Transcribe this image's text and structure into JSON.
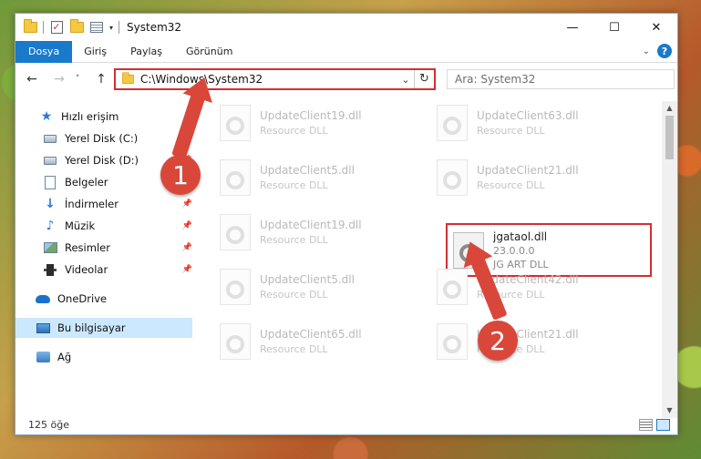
{
  "window": {
    "title": "System32",
    "minimize": "—",
    "maximize": "☐",
    "close": "✕"
  },
  "ribbon": {
    "tabs": [
      "Dosya",
      "Giriş",
      "Paylaş",
      "Görünüm"
    ],
    "help": "?"
  },
  "nav": {
    "back": "←",
    "forward": "→",
    "recent": "˅",
    "up": "↑"
  },
  "address": {
    "path": "C:\\Windows\\System32",
    "refresh": "↻"
  },
  "search": {
    "placeholder": "Ara: System32"
  },
  "sidebar": {
    "items": [
      {
        "label": "Hızlı erişim",
        "icon": "star-icon",
        "pinned": false
      },
      {
        "label": "Yerel Disk (C:)",
        "icon": "drive-icon",
        "pinned": true
      },
      {
        "label": "Yerel Disk (D:)",
        "icon": "drive-icon",
        "pinned": true
      },
      {
        "label": "Belgeler",
        "icon": "document-icon",
        "pinned": true
      },
      {
        "label": "İndirmeler",
        "icon": "download-icon",
        "pinned": true
      },
      {
        "label": "Müzik",
        "icon": "music-icon",
        "pinned": true
      },
      {
        "label": "Resimler",
        "icon": "pictures-icon",
        "pinned": true
      },
      {
        "label": "Videolar",
        "icon": "video-icon",
        "pinned": true
      },
      {
        "label": "OneDrive",
        "icon": "cloud-icon",
        "pinned": false
      },
      {
        "label": "Bu bilgisayar",
        "icon": "computer-icon",
        "pinned": false,
        "selected": true
      },
      {
        "label": "Ağ",
        "icon": "network-icon",
        "pinned": false
      }
    ]
  },
  "files": [
    {
      "name": "UpdateClient19.dll",
      "desc": "Resource DLL"
    },
    {
      "name": "UpdateClient63.dll",
      "desc": "Resource DLL"
    },
    {
      "name": "UpdateClient5.dll",
      "desc": "Resource DLL"
    },
    {
      "name": "UpdateClient21.dll",
      "desc": "Resource DLL"
    },
    {
      "name": "UpdateClient19.dll",
      "desc": "Resource DLL"
    },
    {
      "name": "UpdateClient5.dll",
      "desc": "Resource DLL"
    },
    {
      "name": "UpdateClient42.dll",
      "desc": "Resource DLL"
    },
    {
      "name": "UpdateClient65.dll",
      "desc": "Resource DLL"
    },
    {
      "name": "UpdateClient21.dll",
      "desc": "Resource DLL"
    }
  ],
  "highlighted_file": {
    "name": "jgataol.dll",
    "version": "23.0.0.0",
    "desc": "JG ART DLL"
  },
  "status": {
    "count": "125 öğe"
  },
  "callouts": [
    "1",
    "2"
  ],
  "accent_color": "#1979ca",
  "highlight_color": "#d32f2f"
}
